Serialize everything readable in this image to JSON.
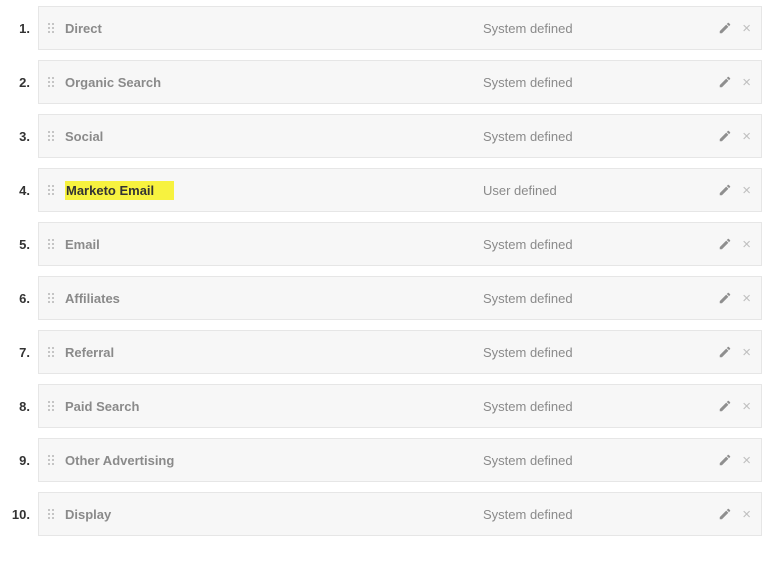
{
  "channels": [
    {
      "num": "1.",
      "name": "Direct",
      "type": "System defined",
      "highlight": false
    },
    {
      "num": "2.",
      "name": "Organic Search",
      "type": "System defined",
      "highlight": false
    },
    {
      "num": "3.",
      "name": "Social",
      "type": "System defined",
      "highlight": false
    },
    {
      "num": "4.",
      "name": "Marketo Email",
      "type": "User defined",
      "highlight": true
    },
    {
      "num": "5.",
      "name": "Email",
      "type": "System defined",
      "highlight": false
    },
    {
      "num": "6.",
      "name": "Affiliates",
      "type": "System defined",
      "highlight": false
    },
    {
      "num": "7.",
      "name": "Referral",
      "type": "System defined",
      "highlight": false
    },
    {
      "num": "8.",
      "name": "Paid Search",
      "type": "System defined",
      "highlight": false
    },
    {
      "num": "9.",
      "name": "Other Advertising",
      "type": "System defined",
      "highlight": false
    },
    {
      "num": "10.",
      "name": "Display",
      "type": "System defined",
      "highlight": false
    }
  ]
}
